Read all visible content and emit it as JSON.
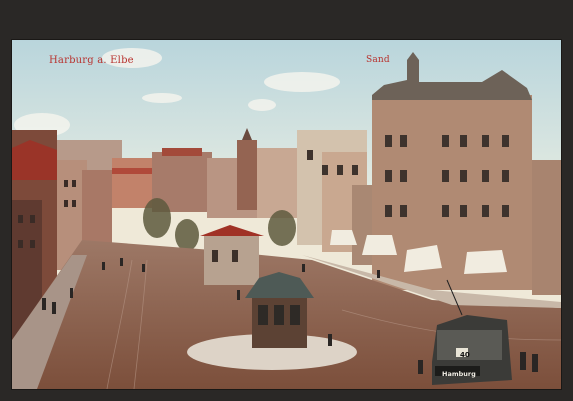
{
  "postcard": {
    "title": "Harburg a. Elbe",
    "place": "Sand",
    "tram_destination": "Hamburg",
    "tram_route_number": "40"
  },
  "colors": {
    "caption": "#b8322e",
    "sky": "#dde8e3",
    "paving": "#8c5a44"
  }
}
